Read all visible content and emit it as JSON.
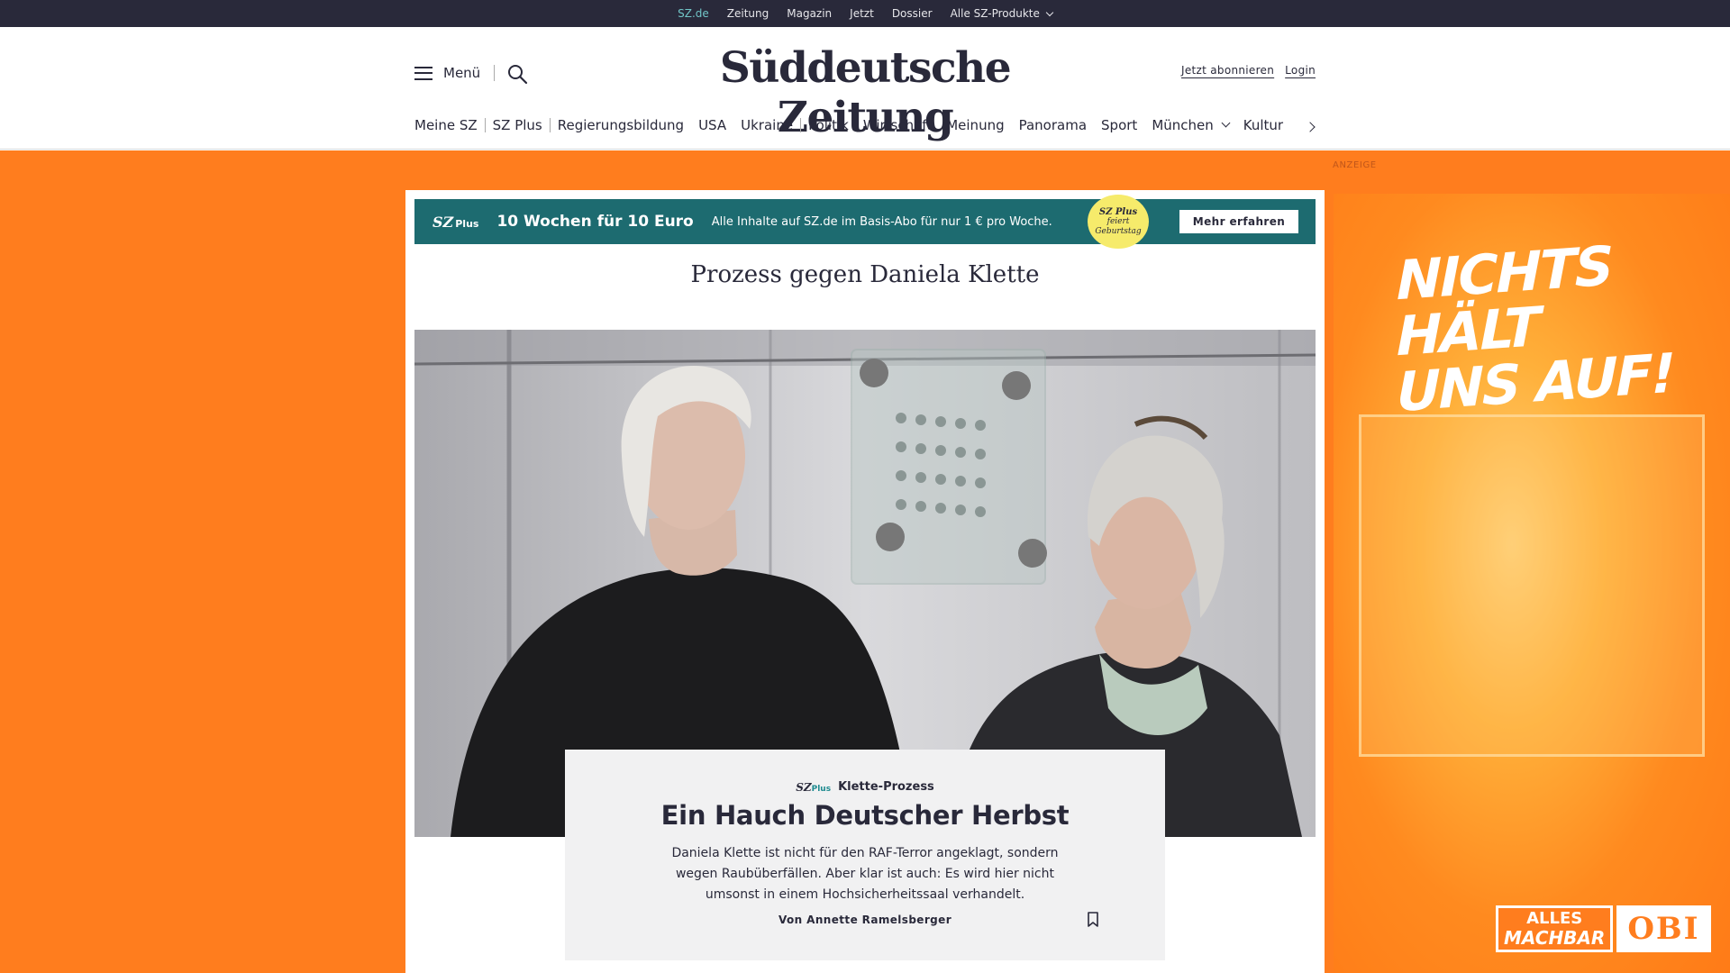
{
  "topbar": {
    "items": [
      "SZ.de",
      "Zeitung",
      "Magazin",
      "Jetzt",
      "Dossier",
      "Alle SZ-Produkte"
    ]
  },
  "header": {
    "menu_label": "Menü",
    "logo_text": "Süddeutsche Zeitung",
    "subscribe_label": "Jetzt abonnieren",
    "login_label": "Login"
  },
  "nav": {
    "items": [
      "Meine SZ",
      "SZ Plus",
      "Regierungsbildung",
      "USA",
      "Ukraine",
      "Politik",
      "Wirtschaft",
      "Meinung",
      "Panorama",
      "Sport",
      "München",
      "Kultur"
    ]
  },
  "ad_label": "ANZEIGE",
  "promo": {
    "logo": "SZ",
    "logo_suffix": "Plus",
    "title": "10 Wochen für 10 Euro",
    "text": "Alle Inhalte auf SZ.de im Basis-Abo für nur 1 € pro Woche.",
    "badge_logo": "SZ Plus",
    "badge_line1": "feiert",
    "badge_line2": "Geburtstag",
    "button": "Mehr erfahren"
  },
  "dossier_title": "Prozess gegen Daniela Klette",
  "teaser": {
    "plus_logo": "SZ",
    "plus_suffix": "Plus",
    "kicker": "Klette-Prozess",
    "title": "Ein Hauch Deutscher Herbst",
    "summary": "Daniela Klette ist nicht für den RAF-Terror angeklagt, sondern wegen Raubüberfällen. Aber klar ist auch: Es wird hier nicht umsonst in einem Hochsicherheitssaal verhandelt.",
    "author": "Von Annette Ramelsberger"
  },
  "obi_ad": {
    "slogan_line1": "NICHTS HÄLT",
    "slogan_line2": "UNS AUF!",
    "tagline_line1": "ALLES",
    "tagline_line2": "MACHBAR",
    "brand": "OBI"
  },
  "colors": {
    "topbar_bg": "#29293a",
    "active_link": "#71c6c8",
    "promo_bg": "#1d6b70",
    "ad_orange": "#ff7d1e",
    "badge_yellow": "#f6eb6b"
  },
  "icons": [
    "hamburger-icon",
    "search-icon",
    "chevron-down-icon",
    "chevron-right-icon",
    "bookmark-icon"
  ]
}
